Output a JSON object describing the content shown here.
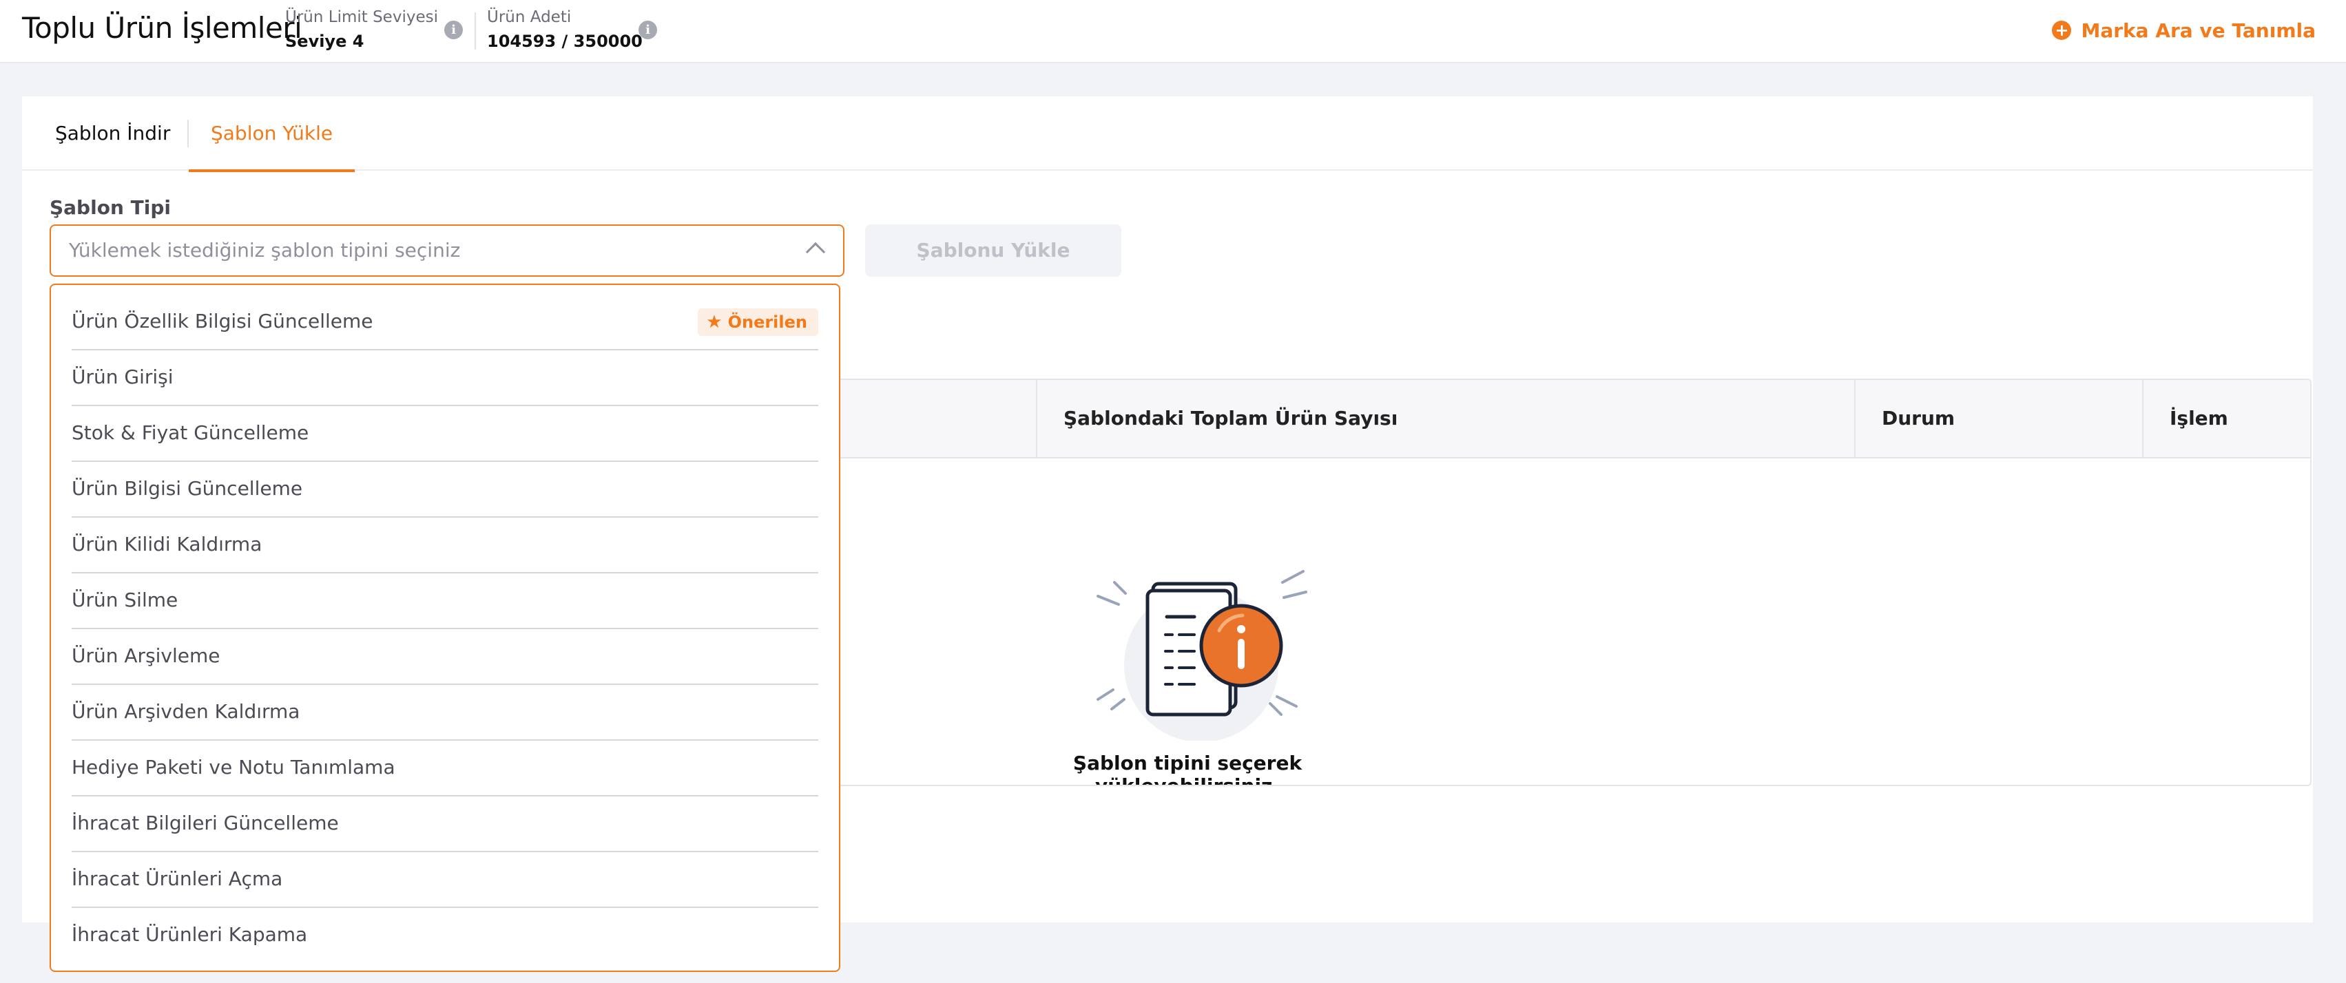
{
  "header": {
    "title": "Toplu Ürün İşlemleri",
    "limit_label": "Ürün Limit Seviyesi",
    "limit_value": "Seviye 4",
    "count_label": "Ürün Adeti",
    "count_value": "104593 / 350000",
    "info_glyph": "i",
    "brand_button_label": "Marka Ara ve Tanımla",
    "plus_glyph": "+"
  },
  "tabs": [
    {
      "label": "Şablon İndir",
      "active": false
    },
    {
      "label": "Şablon Yükle",
      "active": true
    }
  ],
  "form": {
    "field_label": "Şablon Tipi",
    "select_placeholder": "Yüklemek istediğiniz şablon tipini seçiniz",
    "upload_button_label": "Şablonu Yükle"
  },
  "table": {
    "headers": [
      "Şablondaki Toplam Ürün Sayısı",
      "Durum",
      "İşlem"
    ],
    "empty_text": "Şablon tipini seçerek yükleyebilirsiniz."
  },
  "dropdown": {
    "options": [
      {
        "label": "Ürün Özellik Bilgisi Güncelleme",
        "badge": "Önerilen"
      },
      {
        "label": "Ürün Girişi"
      },
      {
        "label": "Stok & Fiyat Güncelleme"
      },
      {
        "label": "Ürün Bilgisi Güncelleme"
      },
      {
        "label": "Ürün Kilidi Kaldırma"
      },
      {
        "label": "Ürün Silme"
      },
      {
        "label": "Ürün Arşivleme"
      },
      {
        "label": "Ürün Arşivden Kaldırma"
      },
      {
        "label": "Hediye Paketi ve Notu Tanımlama"
      },
      {
        "label": "İhracat Bilgileri Güncelleme"
      },
      {
        "label": "İhracat Ürünleri Açma"
      },
      {
        "label": "İhracat Ürünleri Kapama"
      }
    ]
  },
  "colors": {
    "accent": "#f27a1a",
    "badge_bg": "#fdeee3",
    "page_bg": "#f2f3f7",
    "illustration_circle": "#e9732a"
  },
  "icons": [
    "info-icon",
    "plus-circle-icon",
    "chevron-up-icon",
    "star-icon",
    "document-info-icon"
  ]
}
